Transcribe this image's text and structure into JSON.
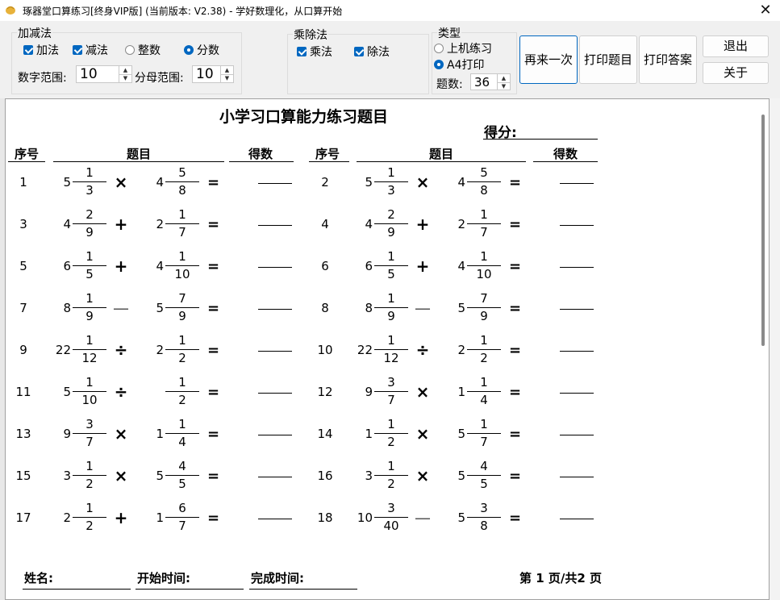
{
  "title": {
    "text": "琢器堂口算练习[终身VIP版] (当前版本: V2.38) -      学好数理化，从口算开始",
    "close": "✕"
  },
  "add_sub": {
    "group": "加减法",
    "add": "加法",
    "sub": "减法",
    "integer": "整数",
    "fraction": "分数",
    "range_label": "数字范围:",
    "range_value": "10",
    "denom_label": "分母范围:",
    "denom_value": "10"
  },
  "mul_div": {
    "group": "乘除法",
    "mul": "乘法",
    "div": "除法"
  },
  "type": {
    "group": "类型",
    "online": "上机练习",
    "print": "A4打印",
    "count_label": "题数:",
    "count_value": "36"
  },
  "buttons": {
    "again": "再来一次",
    "print_q": "打印题目",
    "print_a": "打印答案",
    "exit": "退出",
    "about": "关于"
  },
  "sheet": {
    "title": "小学习口算能力练习题目",
    "score": "得分:",
    "headers": {
      "no": "序号",
      "question": "题目",
      "points": "得数"
    },
    "footer": {
      "name": "姓名:",
      "start": "开始时间:",
      "end": "完成时间:",
      "page": "第 1 页/共2 页"
    }
  },
  "problems": [
    {
      "no": "1",
      "w1": "5",
      "n1": "1",
      "d1": "3",
      "op": "×",
      "w2": "4",
      "n2": "5",
      "d2": "8"
    },
    {
      "no": "2",
      "w1": "5",
      "n1": "1",
      "d1": "3",
      "op": "×",
      "w2": "4",
      "n2": "5",
      "d2": "8"
    },
    {
      "no": "3",
      "w1": "4",
      "n1": "2",
      "d1": "9",
      "op": "+",
      "w2": "2",
      "n2": "1",
      "d2": "7"
    },
    {
      "no": "4",
      "w1": "4",
      "n1": "2",
      "d1": "9",
      "op": "+",
      "w2": "2",
      "n2": "1",
      "d2": "7"
    },
    {
      "no": "5",
      "w1": "6",
      "n1": "1",
      "d1": "5",
      "op": "+",
      "w2": "4",
      "n2": "1",
      "d2": "10"
    },
    {
      "no": "6",
      "w1": "6",
      "n1": "1",
      "d1": "5",
      "op": "+",
      "w2": "4",
      "n2": "1",
      "d2": "10"
    },
    {
      "no": "7",
      "w1": "8",
      "n1": "1",
      "d1": "9",
      "op": "—",
      "w2": "5",
      "n2": "7",
      "d2": "9"
    },
    {
      "no": "8",
      "w1": "8",
      "n1": "1",
      "d1": "9",
      "op": "—",
      "w2": "5",
      "n2": "7",
      "d2": "9"
    },
    {
      "no": "9",
      "w1": "22",
      "n1": "1",
      "d1": "12",
      "op": "÷",
      "w2": "2",
      "n2": "1",
      "d2": "2"
    },
    {
      "no": "10",
      "w1": "22",
      "n1": "1",
      "d1": "12",
      "op": "÷",
      "w2": "2",
      "n2": "1",
      "d2": "2"
    },
    {
      "no": "11",
      "w1": "5",
      "n1": "1",
      "d1": "10",
      "op": "÷",
      "w2": "",
      "n2": "1",
      "d2": "2"
    },
    {
      "no": "12",
      "w1": "9",
      "n1": "3",
      "d1": "7",
      "op": "×",
      "w2": "1",
      "n2": "1",
      "d2": "4"
    },
    {
      "no": "13",
      "w1": "9",
      "n1": "3",
      "d1": "7",
      "op": "×",
      "w2": "1",
      "n2": "1",
      "d2": "4"
    },
    {
      "no": "14",
      "w1": "1",
      "n1": "1",
      "d1": "2",
      "op": "×",
      "w2": "5",
      "n2": "1",
      "d2": "7"
    },
    {
      "no": "15",
      "w1": "3",
      "n1": "1",
      "d1": "2",
      "op": "×",
      "w2": "5",
      "n2": "4",
      "d2": "5"
    },
    {
      "no": "16",
      "w1": "3",
      "n1": "1",
      "d1": "2",
      "op": "×",
      "w2": "5",
      "n2": "4",
      "d2": "5"
    },
    {
      "no": "17",
      "w1": "2",
      "n1": "1",
      "d1": "2",
      "op": "+",
      "w2": "1",
      "n2": "6",
      "d2": "7"
    },
    {
      "no": "18",
      "w1": "10",
      "n1": "3",
      "d1": "40",
      "op": "—",
      "w2": "5",
      "n2": "3",
      "d2": "8"
    }
  ],
  "equals": "="
}
